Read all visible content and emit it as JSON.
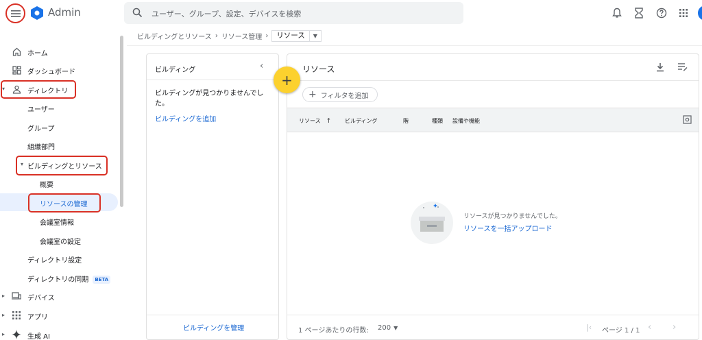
{
  "header": {
    "app_title": "Admin",
    "search_placeholder": "ユーザー、グループ、設定、デバイスを検索",
    "icons": [
      "menu-icon",
      "admin-logo",
      "search-icon",
      "bell-icon",
      "hourglass-icon",
      "help-icon",
      "apps-grid-icon",
      "account-avatar"
    ],
    "brand_color": "#1a73e8"
  },
  "breadcrumb": {
    "items": [
      "ビルディングとリソース",
      "リソース管理"
    ],
    "current": "リソース"
  },
  "sidebar": {
    "home": "ホーム",
    "dashboard": "ダッシュボード",
    "directory": "ディレクトリ",
    "users": "ユーザー",
    "groups": "グループ",
    "org_units": "組織部門",
    "buildings_resources": "ビルディングとリソース",
    "overview": "概要",
    "resource_management": "リソースの管理",
    "room_info": "会議室情報",
    "room_settings": "会議室の設定",
    "directory_settings": "ディレクトリ設定",
    "directory_sync": "ディレクトリの同期",
    "beta": "BETA",
    "devices": "デバイス",
    "apps": "アプリ",
    "gen_ai": "生成 AI"
  },
  "buildings_panel": {
    "title": "ビルディング",
    "empty_message": "ビルディングが見つかりませんでした。",
    "add_link": "ビルディングを追加",
    "manage_link": "ビルディングを管理"
  },
  "fab": {
    "label": "+",
    "color": "#fcd12e"
  },
  "resources_panel": {
    "title": "リソース",
    "filter_label": "フィルタを追加",
    "columns": {
      "resource": "リソース",
      "sort_arrow": "↑",
      "building": "ビルディング",
      "floor": "階",
      "type": "種類",
      "features": "設備や機能"
    },
    "empty_message": "リソースが見つかりませんでした。",
    "bulk_upload_link": "リソースを一括アップロード",
    "pager": {
      "rows_label": "1 ページあたりの行数:",
      "rows_value": "200",
      "page_text": "ページ 1 / 1"
    }
  },
  "annotation_color": "#d93025"
}
